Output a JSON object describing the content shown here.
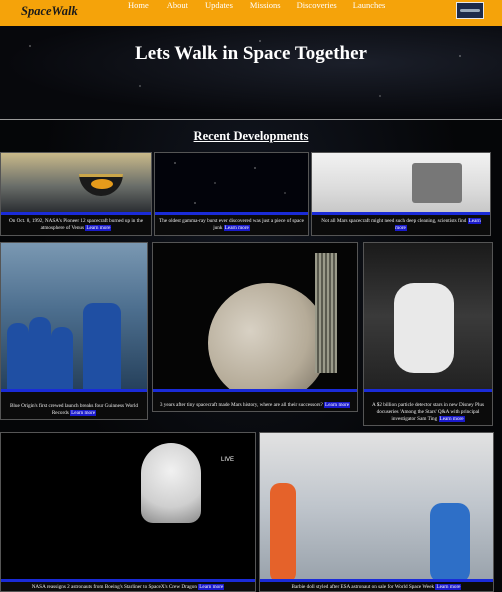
{
  "brand": "SpaceWalk",
  "nav": [
    "Home",
    "About",
    "Updates",
    "Missions",
    "Discoveries",
    "Launches"
  ],
  "hero_title": "Lets Walk in Space Together",
  "section_title": "Recent Developments",
  "cards": [
    {
      "caption": "On Oct. 8, 1992, NASA's Pioneer 12 spacecraft burned up in the atmosphere of Venus",
      "link": "Learn more"
    },
    {
      "caption": "The oldest gamma-ray burst ever discovered was just a piece of space junk",
      "link": "Learn more"
    },
    {
      "caption": "Not all Mars spacecraft might need such deep cleaning, scientists find",
      "link": "Learn more"
    },
    {
      "caption": "Blue Origin's first crewed launch breaks four Guinness World Records",
      "link": "Learn more"
    },
    {
      "caption": "3 years after tiny spacecraft made Mars history, where are all their successors?",
      "link": "Learn more"
    },
    {
      "caption": "A $2 billion particle detector stars in new Disney Plus docuseries 'Among the Stars' Q&A with principal investigator Sam Ting",
      "link": "Learn more"
    },
    {
      "caption": "NASA reassigns 2 astronauts from Boeing's Starliner to SpaceX's Crew Dragon",
      "link": "Learn more"
    },
    {
      "caption": "Barbie doll styled after ESA astronaut on sale for World Space Week",
      "link": "Learn more"
    }
  ],
  "image_labels": {
    "nasa_live": "LIVE"
  }
}
